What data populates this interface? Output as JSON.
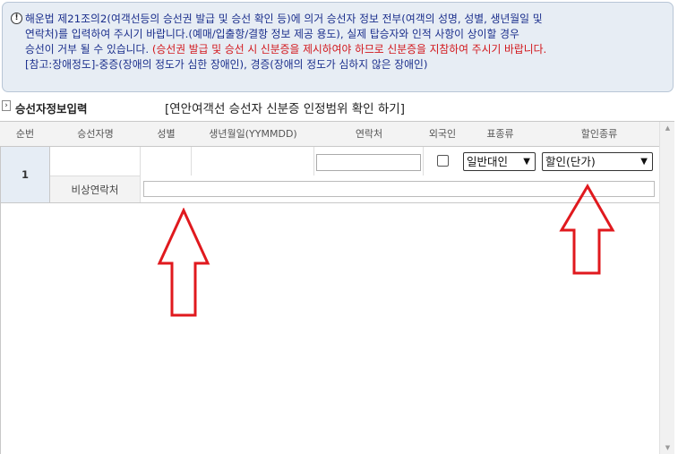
{
  "notice": {
    "icon": "exclamation-icon",
    "line1": "해운법 제21조의2(여객선등의 승선권 발급 및 승선 확인 등)에 의거 승선자 정보 전부(여객의 성명, 성별, 생년월일 및",
    "line2": "연락처)를 입력하여 주시기 바랍니다.(예매/입출항/결항 정보 제공 용도), 실제 탑승자와 인적 사항이 상이할 경우",
    "line3a": "승선이 거부 될 수 있습니다. ",
    "line3b": "(승선권 발급 및 승선 시 신분증을 제시하여야 하므로 신분증을 지참하여 주시기 바랍니다.",
    "line4": "[참고:장애정도]-중증(장애의 정도가 심한 장애인), 경증(장애의 정도가 심하지 않은 장애인)"
  },
  "section": {
    "title": "승선자정보입력",
    "link": "[연안여객선 승선자 신분증 인정범위 확인 하기]"
  },
  "table": {
    "headers": {
      "seq": "순번",
      "name": "승선자명",
      "gender": "성별",
      "birth": "생년월일(YYMMDD)",
      "contact": "연락처",
      "foreigner": "외국인",
      "ticket_type": "표종류",
      "discount_type": "할인종류"
    },
    "row": {
      "seq": "1",
      "name_value": "",
      "gender_value": "",
      "birth_value": "",
      "contact_value": "",
      "foreigner_checked": false,
      "ticket_type_value": "일반대인",
      "discount_type_value": "할인(단가)",
      "emergency_label": "비상연락처",
      "emergency_value": ""
    }
  },
  "colors": {
    "notice_bg": "#e7edf4",
    "notice_text": "#1a2e8c",
    "notice_red": "#d2151a",
    "annotation_arrow": "#e0191e"
  }
}
